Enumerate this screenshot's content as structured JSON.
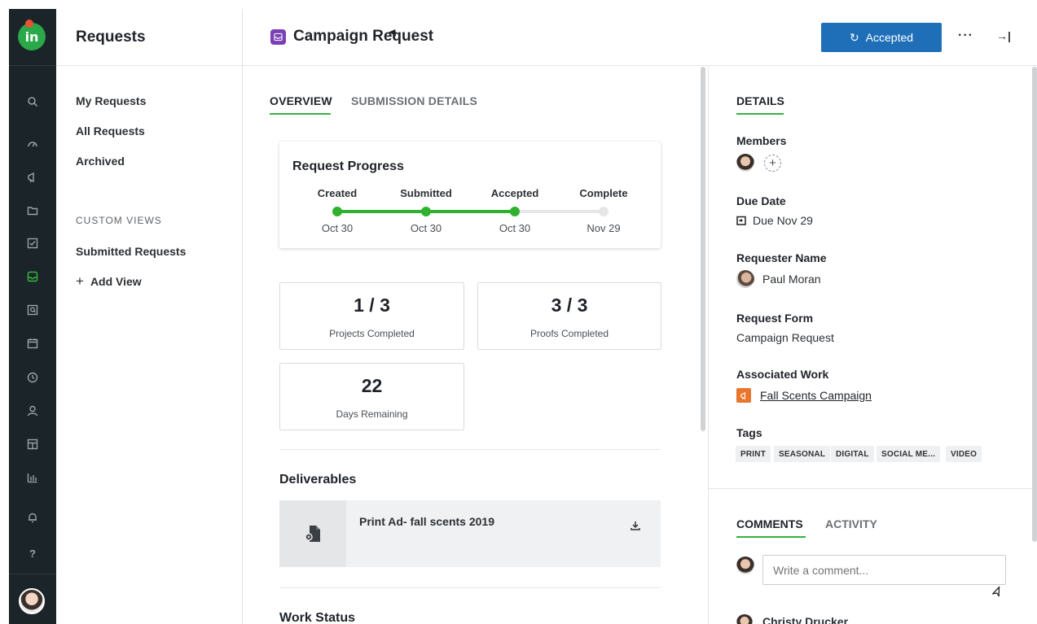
{
  "sidebar": {
    "title": "Requests",
    "items": [
      {
        "label": "My Requests"
      },
      {
        "label": "All Requests"
      },
      {
        "label": "Archived"
      }
    ],
    "section_label": "CUSTOM VIEWS",
    "custom_views": [
      {
        "label": "Submitted Requests"
      }
    ],
    "add_view_label": "Add View",
    "add_view_icon": "plus-icon"
  },
  "rail": {
    "logo_text": "in",
    "icons": [
      "search-icon",
      "dashboard-icon",
      "megaphone-icon",
      "folder-icon",
      "checkbox-icon",
      "inbox-icon",
      "review-icon",
      "calendar-icon",
      "clock-icon",
      "person-icon",
      "layout-icon",
      "reports-icon",
      "bell-icon",
      "help-icon"
    ],
    "active_color": "#36b23d"
  },
  "header": {
    "title": "Campaign Request",
    "status_label": "Accepted",
    "more_label": "···",
    "collapse_label": "→|",
    "accent": "#1f6fb8"
  },
  "main": {
    "tabs": [
      {
        "label": "OVERVIEW",
        "active": true
      },
      {
        "label": "SUBMISSION DETAILS",
        "active": false
      }
    ],
    "progress": {
      "title": "Request Progress",
      "steps": [
        {
          "label": "Created",
          "date": "Oct 30",
          "done": true
        },
        {
          "label": "Submitted",
          "date": "Oct 30",
          "done": true
        },
        {
          "label": "Accepted",
          "date": "Oct 30",
          "done": true
        },
        {
          "label": "Complete",
          "date": "Nov 29",
          "done": false
        }
      ]
    },
    "stats": [
      {
        "value": "1 / 3",
        "label": "Projects Completed"
      },
      {
        "value": "3 / 3",
        "label": "Proofs Completed"
      },
      {
        "value": "22",
        "label": "Days Remaining"
      }
    ],
    "deliverables_title": "Deliverables",
    "deliverables": [
      {
        "name": "Print Ad- fall scents 2019",
        "icon": "document-icon",
        "action_icon": "download-icon"
      }
    ],
    "work_status_title": "Work Status"
  },
  "details": {
    "tab_label": "DETAILS",
    "members_label": "Members",
    "due_date_label": "Due Date",
    "due_date_value": "Due Nov 29",
    "requester_label": "Requester Name",
    "requester_value": "Paul Moran",
    "form_label": "Request Form",
    "form_value": "Campaign Request",
    "work_label": "Associated Work",
    "work_value": "Fall Scents Campaign",
    "tags_label": "Tags",
    "tags": [
      "PRINT",
      "SEASONAL",
      "DIGITAL",
      "SOCIAL ME...",
      "VIDEO"
    ]
  },
  "comments": {
    "tabs": [
      {
        "label": "COMMENTS",
        "active": true
      },
      {
        "label": "ACTIVITY",
        "active": false
      }
    ],
    "input_placeholder": "Write a comment...",
    "first_author": "Christy Drucker"
  }
}
